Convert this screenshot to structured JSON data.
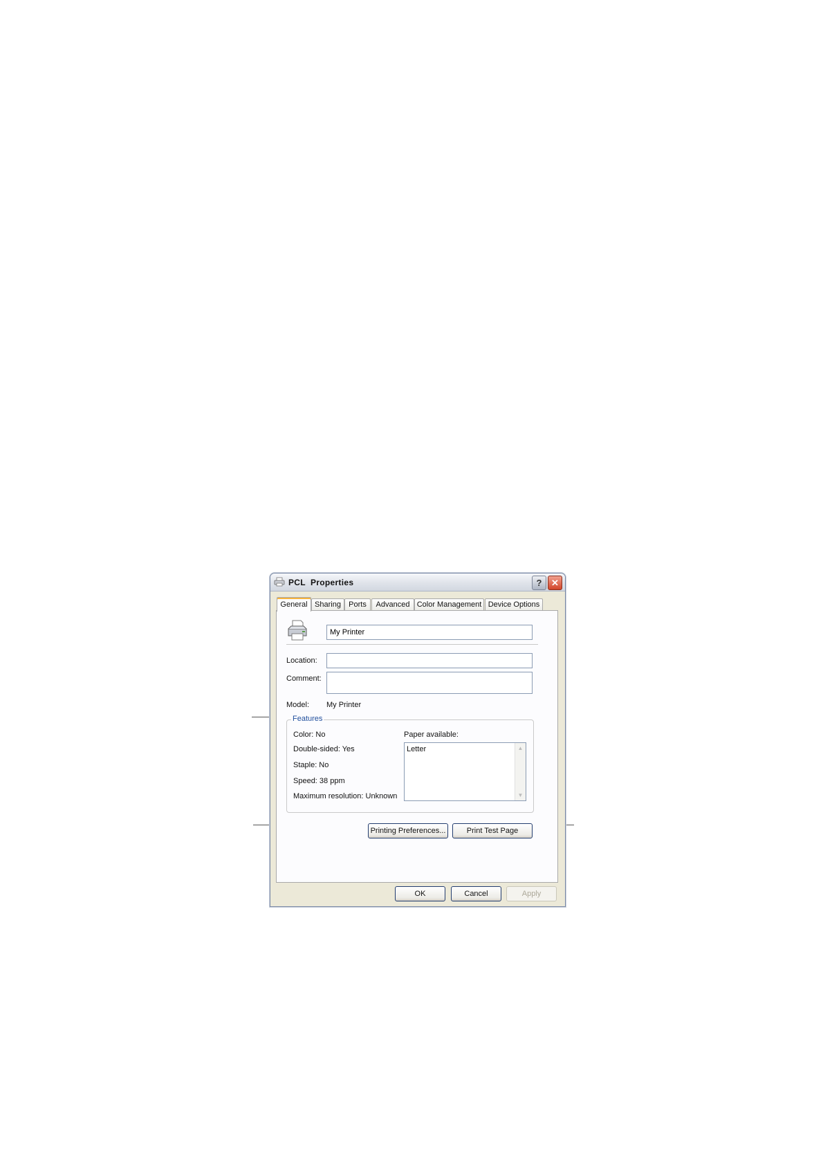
{
  "window": {
    "title": "PCL  Properties",
    "help_glyph": "?",
    "close_glyph": "✕"
  },
  "tabs": [
    {
      "label": "General"
    },
    {
      "label": "Sharing"
    },
    {
      "label": "Ports"
    },
    {
      "label": "Advanced"
    },
    {
      "label": "Color Management"
    },
    {
      "label": "Device Options"
    }
  ],
  "general": {
    "printer_name": "My Printer",
    "location_label": "Location:",
    "location_value": "",
    "comment_label": "Comment:",
    "comment_value": "",
    "model_label": "Model:",
    "model_value": "My Printer"
  },
  "features": {
    "title": "Features",
    "color": "Color: No",
    "double_sided": "Double-sided: Yes",
    "staple": "Staple: No",
    "speed": "Speed: 38 ppm",
    "max_resolution": "Maximum resolution: Unknown",
    "paper_label": "Paper available:",
    "paper_items": [
      "Letter"
    ]
  },
  "actions": {
    "printing_preferences": "Printing Preferences...",
    "print_test_page": "Print Test Page"
  },
  "footer": {
    "ok": "OK",
    "cancel": "Cancel",
    "apply": "Apply"
  },
  "colors": {
    "tab_accent": "#f7b43c",
    "group_title": "#1f4e9c",
    "dialog_bg": "#ece9d8"
  },
  "icons": {
    "title_icon": "printer-icon",
    "general_icon": "printer-icon"
  }
}
